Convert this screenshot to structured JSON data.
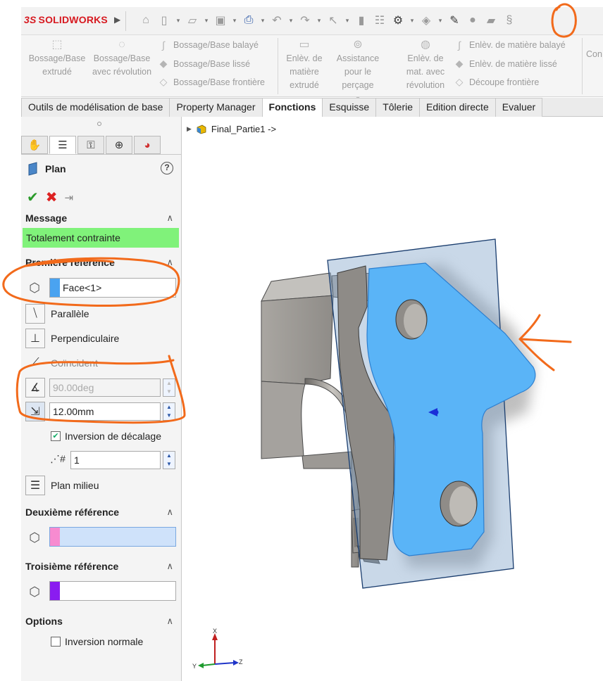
{
  "app": {
    "brand_prefix": "3S",
    "brand": "SOLIDWORKS"
  },
  "ribbon": {
    "boss_extrude": "Bossage/Base extrudé",
    "boss_revolve": "Bossage/Base avec révolution",
    "boss_sweep": "Bossage/Base balayé",
    "boss_loft": "Bossage/Base lissé",
    "boss_boundary": "Bossage/Base frontière",
    "cut_extrude": "Enlèv. de matière extrudé",
    "hole_wizard": "Assistance pour le perçage",
    "cut_revolve": "Enlèv. de mat. avec révolution",
    "cut_sweep": "Enlèv. de matière balayé",
    "cut_loft": "Enlèv. de matière lissé",
    "cut_boundary": "Découpe frontière",
    "more": "Con"
  },
  "tabs": [
    {
      "label": "Outils de modélisation de base"
    },
    {
      "label": "Property Manager"
    },
    {
      "label": "Fonctions"
    },
    {
      "label": "Esquisse"
    },
    {
      "label": "Tôlerie"
    },
    {
      "label": "Edition directe"
    },
    {
      "label": "Evaluer"
    }
  ],
  "panel": {
    "title": "Plan",
    "message_header": "Message",
    "message_text": "Totalement contrainte",
    "first_ref_header": "Première référence",
    "first_ref_value": "Face<1>",
    "parallel": "Parallèle",
    "perpendicular": "Perpendiculaire",
    "coincident": "Coïncident",
    "angle_value": "90.00deg",
    "offset_value": "12.00mm",
    "flip_offset": "Inversion de décalage",
    "instances_value": "1",
    "mid_plane": "Plan milieu",
    "second_ref_header": "Deuxième référence",
    "third_ref_header": "Troisième référence",
    "options_header": "Options",
    "flip_normal": "Inversion normale"
  },
  "viewport": {
    "tree_label": "Final_Partie1 ->",
    "axis_x": "X",
    "axis_y": "Y",
    "axis_z": "Z"
  },
  "colors": {
    "accent_orange": "#f26a1b",
    "face_blue": "#5ab4f7",
    "message_green": "#80f27a",
    "ref2_pink": "#f78bd0",
    "ref3_purple": "#8a1cf0",
    "ref1_blue": "#4aa3f0"
  }
}
